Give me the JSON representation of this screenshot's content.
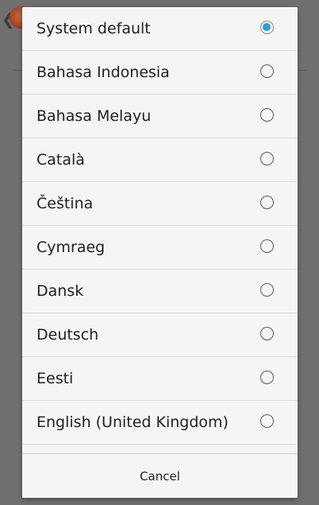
{
  "dialog": {
    "options": [
      {
        "label": "System default",
        "selected": true
      },
      {
        "label": "Bahasa Indonesia",
        "selected": false
      },
      {
        "label": "Bahasa Melayu",
        "selected": false
      },
      {
        "label": "Català",
        "selected": false
      },
      {
        "label": "Čeština",
        "selected": false
      },
      {
        "label": "Cymraeg",
        "selected": false
      },
      {
        "label": "Dansk",
        "selected": false
      },
      {
        "label": "Deutsch",
        "selected": false
      },
      {
        "label": "Eesti",
        "selected": false
      },
      {
        "label": "English (United Kingdom)",
        "selected": false
      }
    ],
    "cancel_label": "Cancel"
  },
  "background": {
    "back_icon": "chevron-left-icon",
    "logo": "app-logo"
  },
  "colors": {
    "accent": "#2a9fd8",
    "dialog_bg": "#f5f5f5",
    "scrim": "#6f6f6f"
  }
}
